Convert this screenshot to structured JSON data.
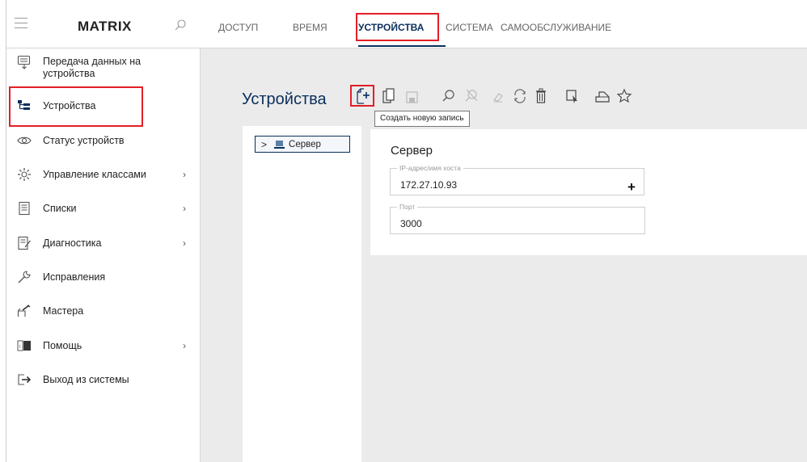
{
  "app": {
    "brand": "MATRIX"
  },
  "nav": {
    "tabs": [
      {
        "label": "ДОСТУП"
      },
      {
        "label": "ВРЕМЯ"
      },
      {
        "label": "УСТРОЙСТВА",
        "active": true
      },
      {
        "label": "СИСТЕМА"
      },
      {
        "label": "САМООБСЛУЖИВАНИЕ"
      }
    ]
  },
  "sidebar": {
    "items": [
      {
        "label_line1": "Передача данных на",
        "label_line2": "устройства",
        "icon": "data-transfer-icon"
      },
      {
        "label": "Устройства",
        "icon": "device-tree-icon",
        "active": true
      },
      {
        "label": "Статус устройств",
        "icon": "eye-icon"
      },
      {
        "label": "Управление классами",
        "icon": "gear-icon",
        "has_submenu": true
      },
      {
        "label": "Списки",
        "icon": "list-icon",
        "has_submenu": true
      },
      {
        "label": "Диагностика",
        "icon": "diagnostics-icon",
        "has_submenu": true
      },
      {
        "label": "Исправления",
        "icon": "wrench-icon"
      },
      {
        "label": "Мастера",
        "icon": "wizard-icon"
      },
      {
        "label": "Помощь",
        "icon": "help-icon",
        "has_submenu": true
      },
      {
        "label": "Выход из системы",
        "icon": "logout-icon"
      }
    ],
    "chevron": "›"
  },
  "main": {
    "title": "Устройства",
    "toolbar": {
      "icons": [
        "new-record-icon",
        "copy-icon",
        "save-icon",
        "search-icon",
        "clear-search-icon",
        "erase-icon",
        "refresh-icon",
        "delete-icon",
        "select-icon",
        "print-icon",
        "favorite-icon"
      ],
      "tooltip": "Создать новую запись"
    },
    "tree": {
      "chevron": ">",
      "node_label": "Сервер"
    },
    "detail": {
      "title": "Сервер",
      "ip_field": {
        "legend": "IP-адрес/имя хоста",
        "value": "172.27.10.93"
      },
      "port_field": {
        "legend": "Порт",
        "value": "3000"
      },
      "add_label": "+"
    }
  },
  "colors": {
    "accent": "#0a2f5c",
    "highlight": "#e21f26"
  }
}
